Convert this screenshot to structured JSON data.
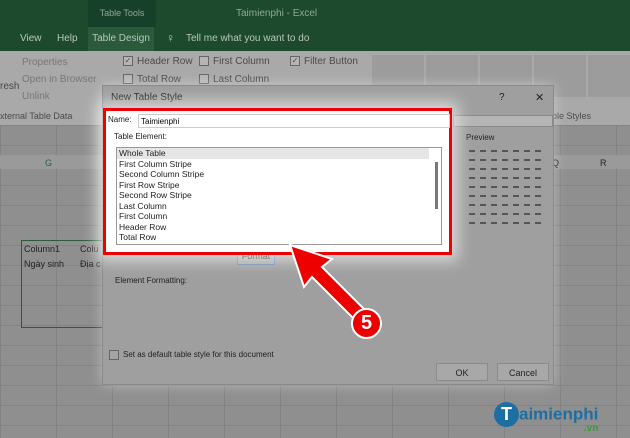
{
  "titlebar": {
    "context": "Table Tools",
    "title": "Taimienphi  -  Excel"
  },
  "tabs": [
    "View",
    "Help",
    "Table Design"
  ],
  "tell_me": "Tell me what you want to do",
  "ribbon": {
    "refresh": "resh",
    "properties": "Properties",
    "open_browser": "Open in Browser",
    "unlink": "Unlink",
    "group_external": "xternal Table Data",
    "header_row": "Header Row",
    "total_row": "Total Row",
    "first_column": "First Column",
    "last_column": "Last Column",
    "filter_button": "Filter Button",
    "group_styles": "ble Styles"
  },
  "sheet": {
    "col_g": "G",
    "col_q": "Q",
    "col_r": "R",
    "cell_col1": "Column1",
    "cell_col2": "Colu",
    "cell_ngay": "Ngày sinh",
    "cell_dia": "Địa c"
  },
  "dialog": {
    "title": "New Table Style",
    "help": "?",
    "close": "✕",
    "name_label": "Name:",
    "name_value": "Taimienphi",
    "element_label": "Table Element:",
    "elements": [
      "Whole Table",
      "First Column Stripe",
      "Second Column Stripe",
      "First Row Stripe",
      "Second Row Stripe",
      "Last Column",
      "First Column",
      "Header Row",
      "Total Row"
    ],
    "format": "Format",
    "preview": "Preview",
    "element_formatting": "Element Formatting:",
    "default_label": "Set as default table style for this document",
    "ok": "OK",
    "cancel": "Cancel"
  },
  "annotation": {
    "step": "5",
    "color": "#e00000"
  },
  "watermark": {
    "brand": "aimienphi",
    "tld": ".vn"
  }
}
